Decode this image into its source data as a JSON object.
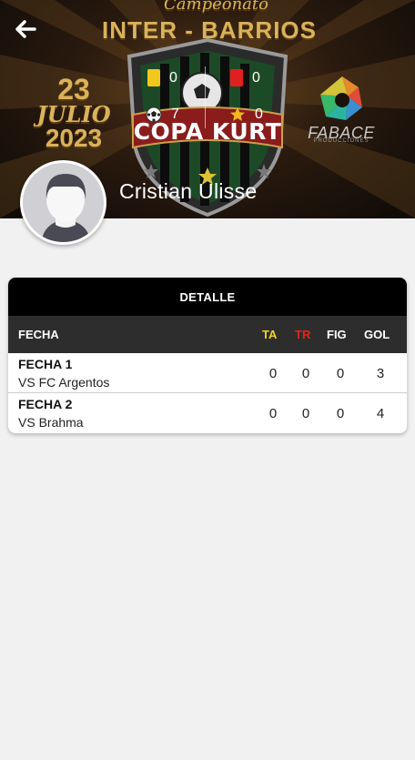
{
  "banner": {
    "campeonato": "Campeonato",
    "inter_barrios": "INTER - BARRIOS",
    "date_day": "23",
    "date_month": "JULIO",
    "date_year": "2023",
    "copa": "COPA KURT",
    "sponsor": "FABACE",
    "sponsor_sub": "PRODUCCIONES"
  },
  "stats": {
    "yellow_cards": "0",
    "red_cards": "0",
    "goals": "7",
    "mvp": "0"
  },
  "player": {
    "name": "Cristian Ulisse"
  },
  "detail": {
    "title": "DETALLE",
    "columns": {
      "fecha": "FECHA",
      "ta": "TA",
      "tr": "TR",
      "fig": "FIG",
      "gol": "GOL"
    },
    "rows": [
      {
        "fecha": "FECHA 1",
        "rival": "VS FC Argentos",
        "ta": "0",
        "tr": "0",
        "fig": "0",
        "gol": "3"
      },
      {
        "fecha": "FECHA 2",
        "rival": "VS Brahma",
        "ta": "0",
        "tr": "0",
        "fig": "0",
        "gol": "4"
      }
    ]
  },
  "colors": {
    "ta": "#f2d51c",
    "tr": "#e0261d",
    "header_bg": "#000000",
    "thead_bg": "#2d2d2d"
  }
}
